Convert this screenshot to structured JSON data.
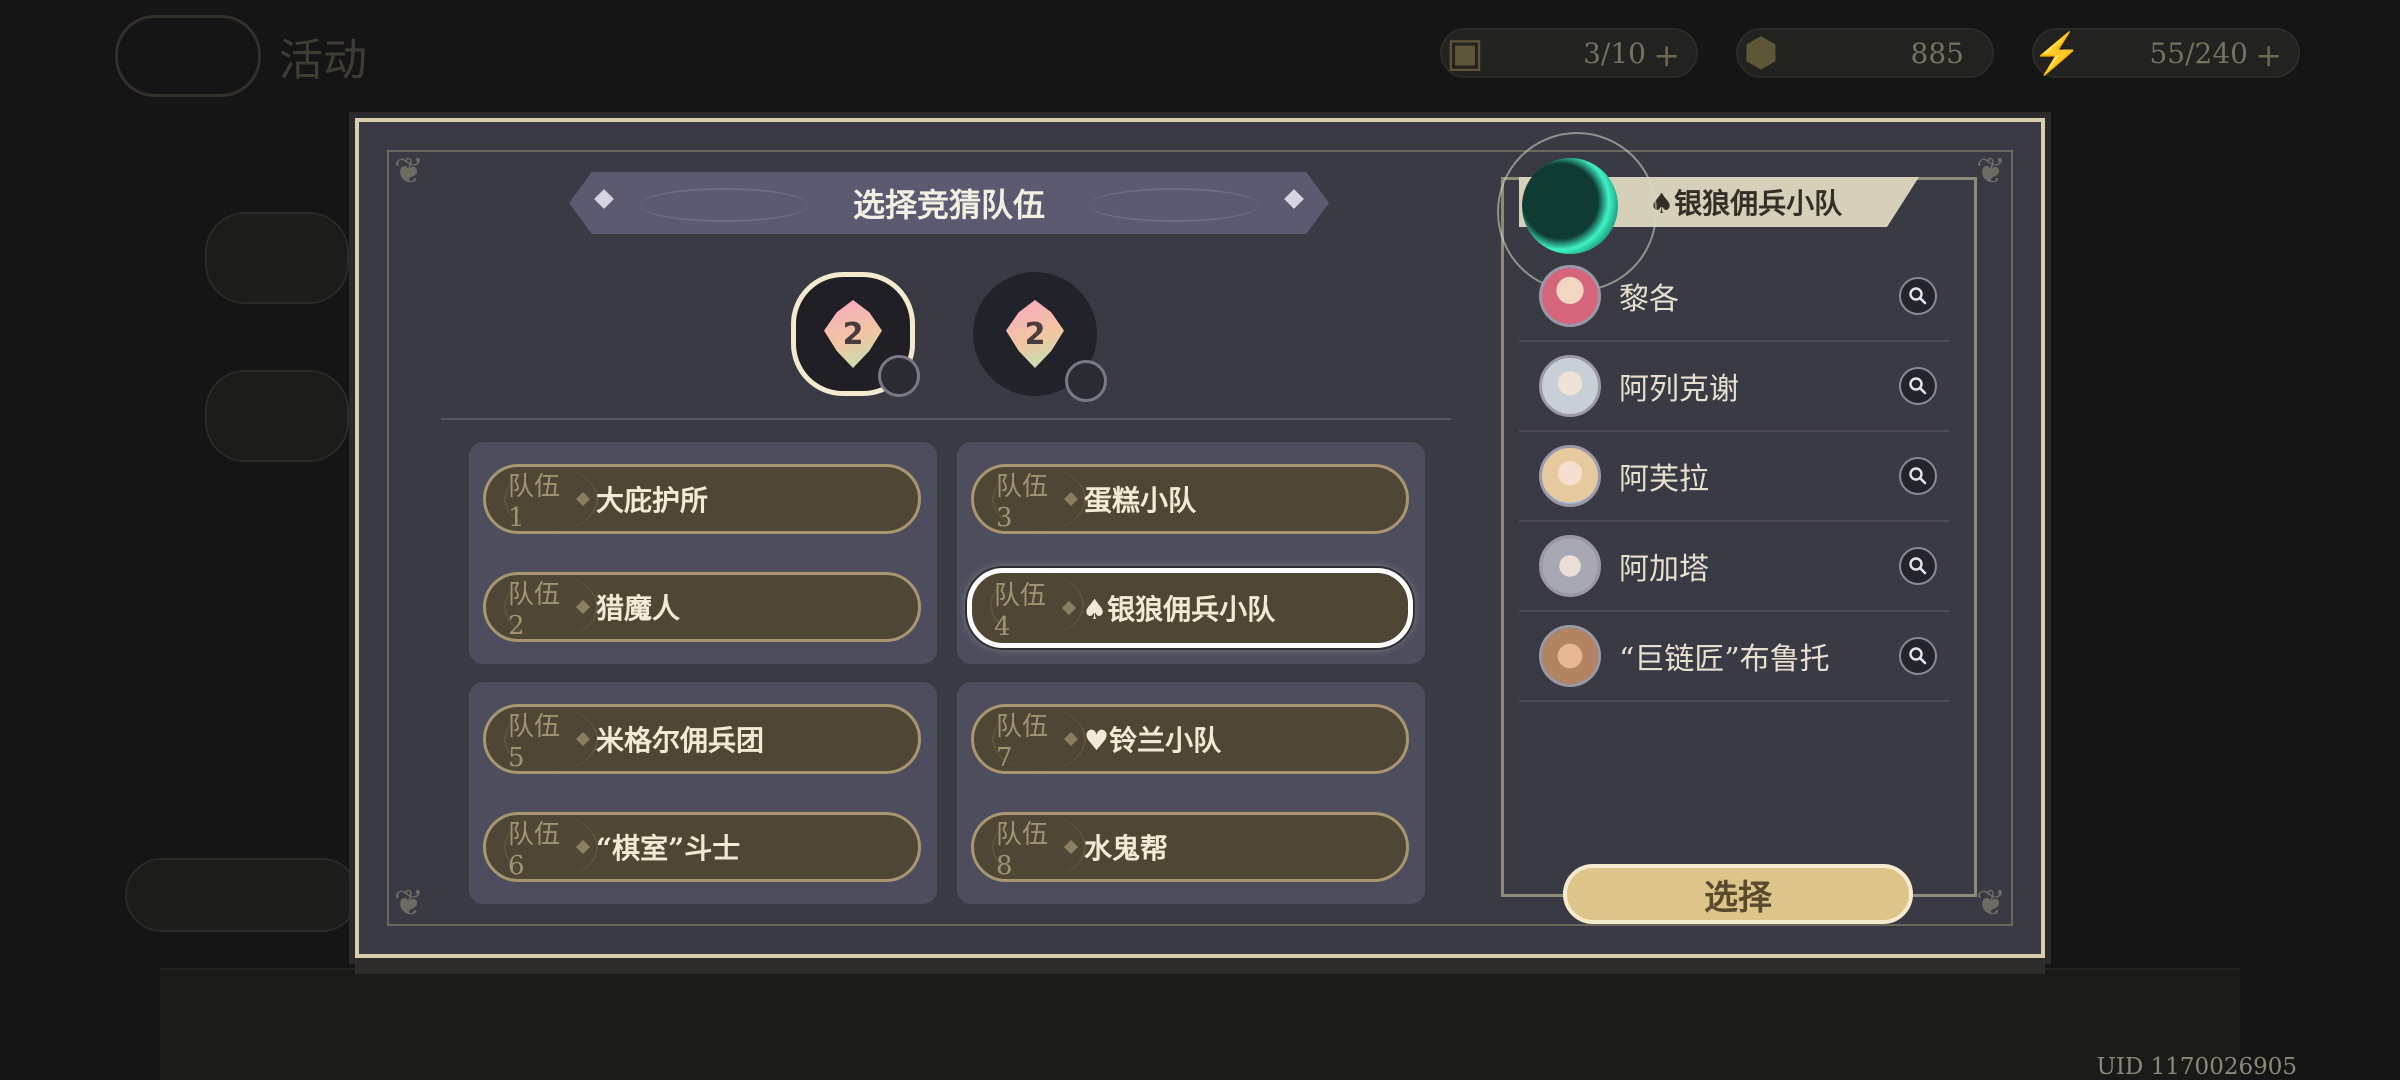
{
  "background": {
    "title": "活动",
    "resources": [
      {
        "icon": "card-icon",
        "value": "3/10"
      },
      {
        "icon": "coin-icon",
        "value": "885"
      },
      {
        "icon": "lightning-icon",
        "value": "55/240"
      }
    ],
    "uid": "UID 1170026905"
  },
  "modal": {
    "title": "选择竞猜队伍",
    "guess_badges": [
      {
        "number": "2",
        "selected": true
      },
      {
        "number": "2",
        "selected": false
      }
    ],
    "groups": [
      {
        "teams": [
          {
            "tag": "队伍1",
            "name": "大庇护所"
          },
          {
            "tag": "队伍2",
            "name": "猎魔人"
          }
        ]
      },
      {
        "teams": [
          {
            "tag": "队伍3",
            "name": "蛋糕小队"
          },
          {
            "tag": "队伍4",
            "name": "♠银狼佣兵小队",
            "selected": true
          }
        ]
      },
      {
        "teams": [
          {
            "tag": "队伍5",
            "name": "米格尔佣兵团"
          },
          {
            "tag": "队伍6",
            "name": "“棋室”斗士"
          }
        ]
      },
      {
        "teams": [
          {
            "tag": "队伍7",
            "name": "♥铃兰小队"
          },
          {
            "tag": "队伍8",
            "name": "水鬼帮"
          }
        ]
      }
    ],
    "panel": {
      "team_name": "♠银狼佣兵小队",
      "members": [
        {
          "name": "黎各",
          "avatar_color": "#d4657a"
        },
        {
          "name": "阿列克谢",
          "avatar_color": "#c9cfd6"
        },
        {
          "name": "阿芙拉",
          "avatar_color": "#e7c9a0"
        },
        {
          "name": "阿加塔",
          "avatar_color": "#a8a8b2"
        },
        {
          "name": "“巨链匠”布鲁托",
          "avatar_color": "#b28462"
        }
      ],
      "choose_label": "选择"
    }
  }
}
